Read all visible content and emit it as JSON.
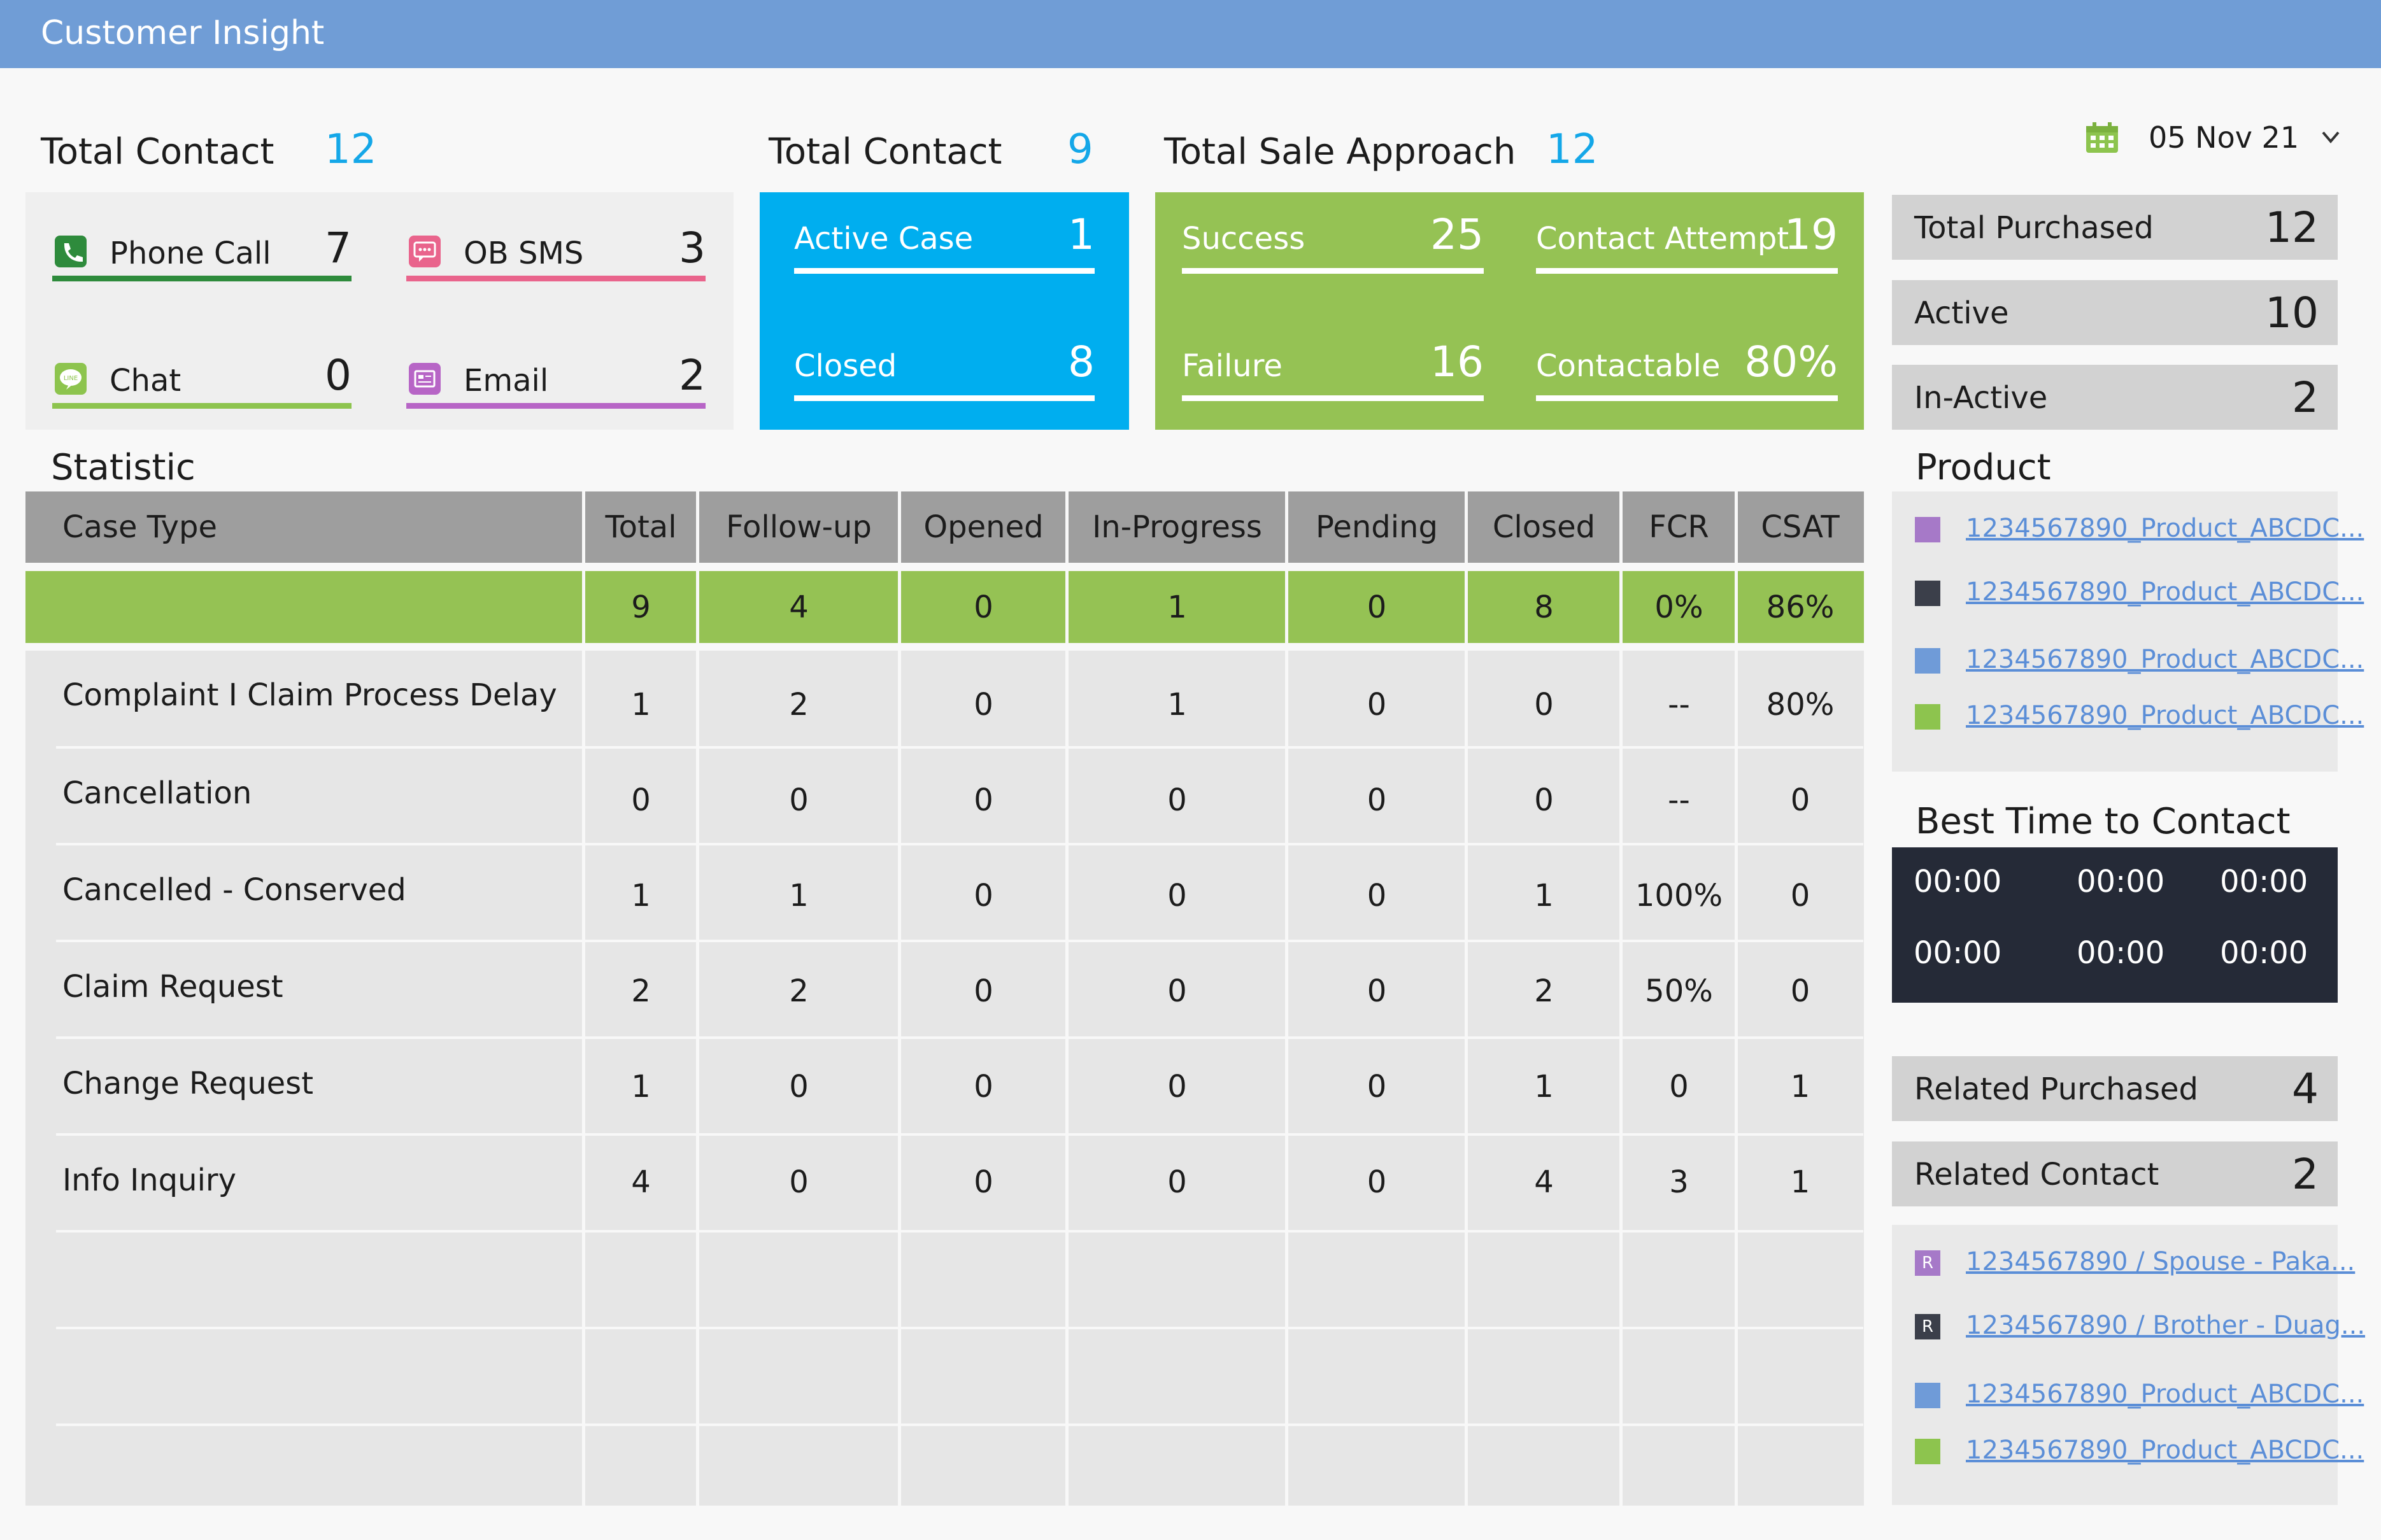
{
  "app": {
    "title": "Customer Insight"
  },
  "header": {
    "total_contact": {
      "label": "Total Contact",
      "value": "12"
    },
    "total_case": {
      "label": "Total Contact",
      "value": "9"
    },
    "total_sale": {
      "label": "Total Sale Approach",
      "value": "12"
    },
    "date": {
      "value": "05 Nov 21",
      "icon": "calendar-icon",
      "dropdown_icon": "chevron-down-icon"
    }
  },
  "channels": [
    {
      "label": "Phone Call",
      "value": "7",
      "color": "#2e8b3c",
      "icon": "phone-icon"
    },
    {
      "label": "OB SMS",
      "value": "3",
      "color": "#e9648c",
      "icon": "sms-icon"
    },
    {
      "label": "Chat",
      "value": "0",
      "color": "#8dc44e",
      "icon": "line-chat-icon"
    },
    {
      "label": "Email",
      "value": "2",
      "color": "#b765c6",
      "icon": "email-icon"
    }
  ],
  "cases": {
    "active": {
      "label": "Active Case",
      "value": "1"
    },
    "closed": {
      "label": "Closed",
      "value": "8"
    }
  },
  "sales": {
    "success": {
      "label": "Success",
      "value": "25"
    },
    "attempt": {
      "label": "Contact Attempt",
      "value": "19"
    },
    "failure": {
      "label": "Failure",
      "value": "16"
    },
    "contactable": {
      "label": "Contactable",
      "value": "80%"
    }
  },
  "purchase": {
    "total": {
      "label": "Total Purchased",
      "value": "12"
    },
    "active": {
      "label": "Active",
      "value": "10"
    },
    "inactive": {
      "label": "In-Active",
      "value": "2"
    }
  },
  "product": {
    "title": "Product",
    "items": [
      {
        "text": "1234567890_Product_ABCDC...",
        "color": "#a679c8"
      },
      {
        "text": "1234567890_Product_ABCDC...",
        "color": "#3b3f4a"
      },
      {
        "text": "1234567890_Product_ABCDC...",
        "color": "#6f9bd8"
      },
      {
        "text": "1234567890_Product_ABCDC...",
        "color": "#8dc44e"
      }
    ]
  },
  "best_time": {
    "title": "Best Time to Contact",
    "times": [
      "00:00",
      "00:00",
      "00:00",
      "00:00",
      "00:00",
      "00:00"
    ]
  },
  "related": {
    "purchased": {
      "label": "Related Purchased",
      "value": "4"
    },
    "contact": {
      "label": "Related Contact",
      "value": "2"
    },
    "items": [
      {
        "text": "1234567890 / Spouse - Paka...",
        "color": "#a679c8",
        "badge": "R"
      },
      {
        "text": "1234567890 / Brother - Duag...",
        "color": "#3b3f4a",
        "badge": "R"
      },
      {
        "text": "1234567890_Product_ABCDC...",
        "color": "#6f9bd8",
        "badge": ""
      },
      {
        "text": "1234567890_Product_ABCDC...",
        "color": "#8dc44e",
        "badge": ""
      }
    ]
  },
  "statistic": {
    "title": "Statistic",
    "columns": [
      "Case Type",
      "Total",
      "Follow-up",
      "Opened",
      "In-Progress",
      "Pending",
      "Closed",
      "FCR",
      "CSAT"
    ],
    "totals": [
      "",
      "9",
      "4",
      "0",
      "1",
      "0",
      "8",
      "0%",
      "86%"
    ],
    "rows": [
      [
        "Complaint I Claim Process Delay",
        "1",
        "2",
        "0",
        "1",
        "0",
        "0",
        "--",
        "80%"
      ],
      [
        "Cancellation",
        "0",
        "0",
        "0",
        "0",
        "0",
        "0",
        "--",
        "0"
      ],
      [
        "Cancelled - Conserved",
        "1",
        "1",
        "0",
        "0",
        "0",
        "1",
        "100%",
        "0"
      ],
      [
        "Claim Request",
        "2",
        "2",
        "0",
        "0",
        "0",
        "2",
        "50%",
        "0"
      ],
      [
        "Change Request",
        "1",
        "0",
        "0",
        "0",
        "0",
        "1",
        "0",
        "1"
      ],
      [
        "Info Inquiry",
        "4",
        "0",
        "0",
        "0",
        "0",
        "4",
        "3",
        "1"
      ]
    ]
  }
}
